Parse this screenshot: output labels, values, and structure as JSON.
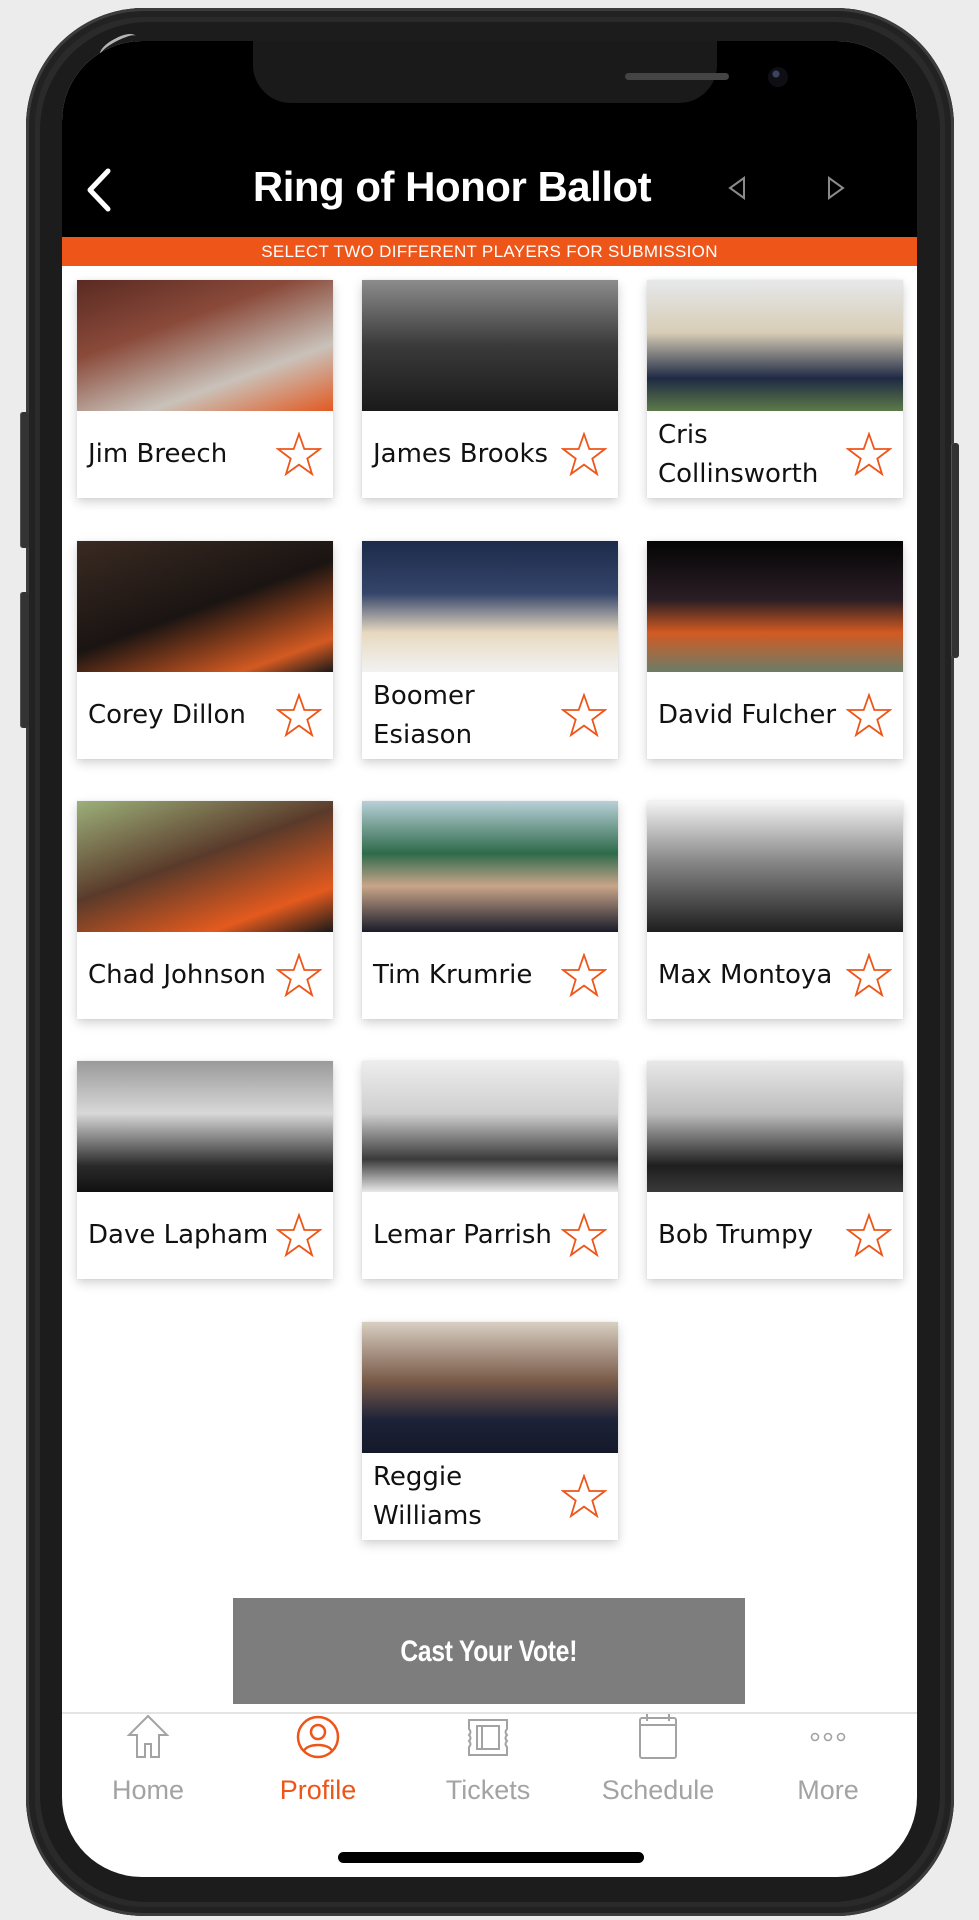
{
  "header": {
    "title": "Ring of Honor Ballot",
    "back_icon": "chevron-left-icon",
    "prev_icon": "triangle-left-icon",
    "next_icon": "triangle-right-icon"
  },
  "banner": {
    "text": "SELECT TWO DIFFERENT PLAYERS FOR SUBMISSION"
  },
  "players": [
    {
      "name": "Jim Breech",
      "selected": false
    },
    {
      "name": "James Brooks",
      "selected": false
    },
    {
      "name": "Cris Collinsworth",
      "selected": false
    },
    {
      "name": "Corey Dillon",
      "selected": false
    },
    {
      "name": "Boomer Esiason",
      "selected": false
    },
    {
      "name": "David Fulcher",
      "selected": false
    },
    {
      "name": "Chad Johnson",
      "selected": false
    },
    {
      "name": "Tim Krumrie",
      "selected": false
    },
    {
      "name": "Max Montoya",
      "selected": false
    },
    {
      "name": "Dave Lapham",
      "selected": false
    },
    {
      "name": "Lemar Parrish",
      "selected": false
    },
    {
      "name": "Bob Trumpy",
      "selected": false
    },
    {
      "name": "Reggie Williams",
      "selected": false
    }
  ],
  "cast_button": {
    "label": "Cast Your Vote!"
  },
  "tab_bar": {
    "active": "Profile",
    "items": [
      {
        "label": "Home",
        "icon": "home-icon"
      },
      {
        "label": "Profile",
        "icon": "profile-icon"
      },
      {
        "label": "Tickets",
        "icon": "ticket-icon"
      },
      {
        "label": "Schedule",
        "icon": "calendar-icon"
      },
      {
        "label": "More",
        "icon": "more-icon"
      }
    ]
  },
  "colors": {
    "accent": "#EE5519",
    "header_bg": "#000000",
    "button_bg": "#7D7D7D",
    "tab_inactive": "#A3A3A3"
  }
}
